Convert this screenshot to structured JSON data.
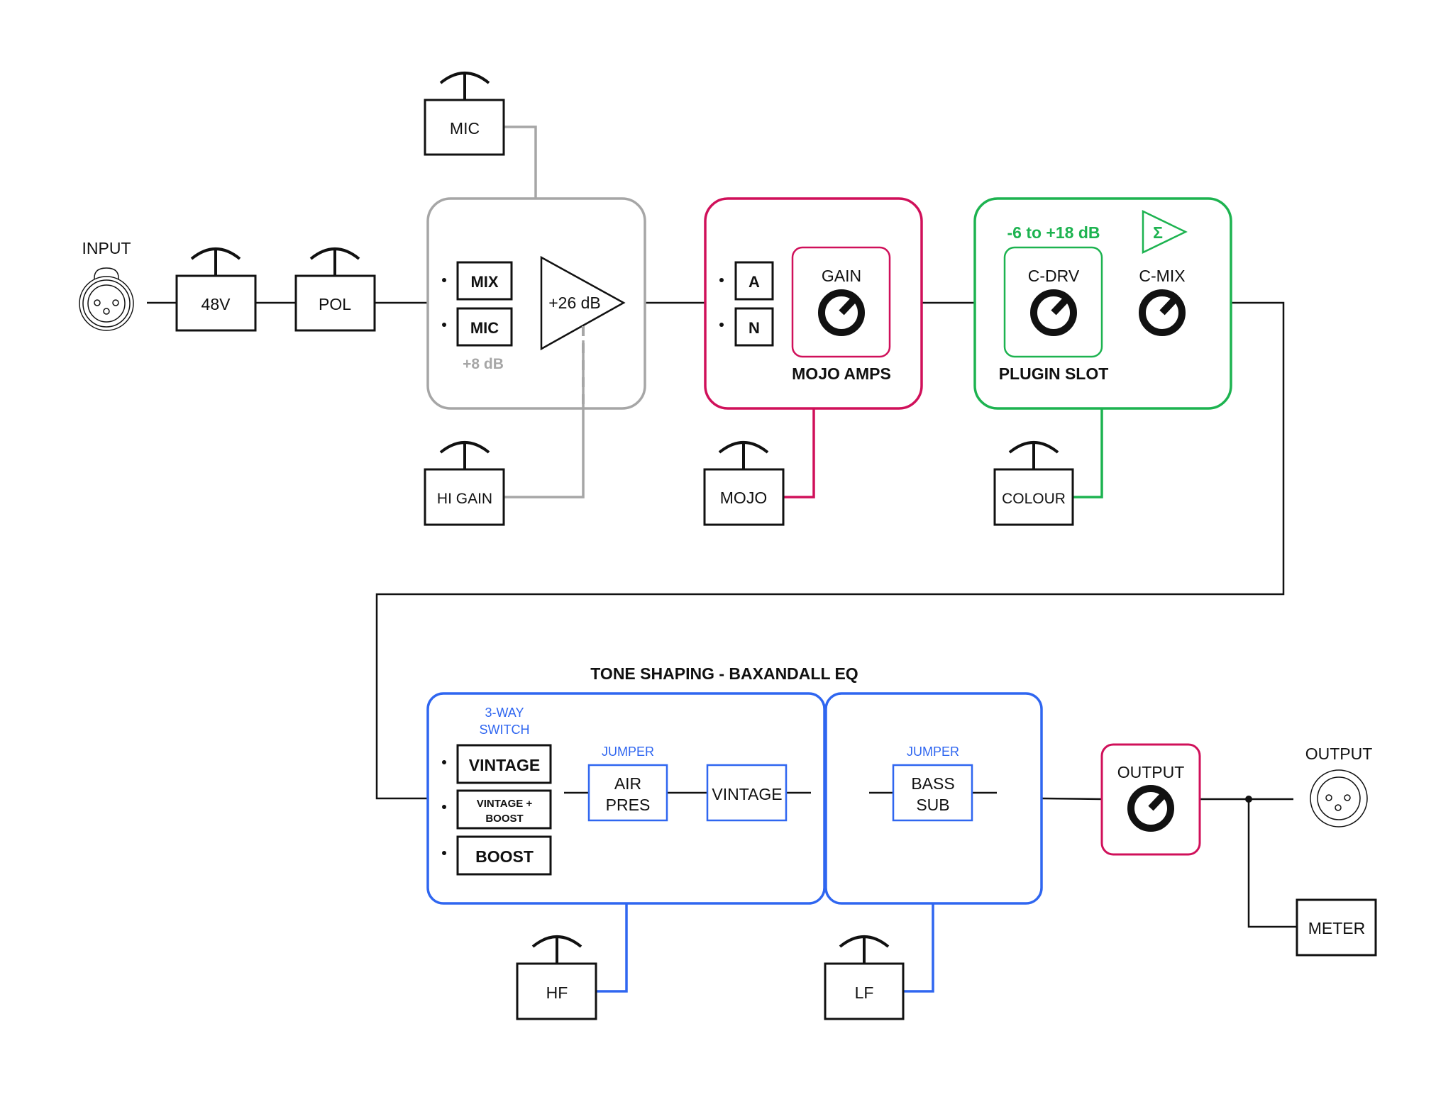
{
  "colors": {
    "line": "#111111",
    "preamp": "#a6a6a6",
    "mojo": "#d0105a",
    "plugin": "#1db350",
    "eq": "#2f66f0"
  },
  "input": {
    "label": "INPUT"
  },
  "chain": {
    "phantom": "48V",
    "polarity": "POL"
  },
  "preamp": {
    "switch_mix": "MIX",
    "switch_mic": "MIC",
    "mic_gain_note": "+8 dB",
    "amp_gain": "+26 dB",
    "control_mic": "MIC",
    "control_hi_gain": "HI GAIN"
  },
  "mojo": {
    "switch_a": "A",
    "switch_n": "N",
    "knob_label": "GAIN",
    "title": "MOJO AMPS",
    "control": "MOJO"
  },
  "plugin": {
    "range": "-6 to +18 dB",
    "sum_symbol": "Σ",
    "knob_cdrv": "C-DRV",
    "knob_cmix": "C-MIX",
    "title": "PLUGIN SLOT",
    "control": "COLOUR"
  },
  "eq": {
    "title": "TONE SHAPING - BAXANDALL EQ",
    "switch_caption_1": "3-WAY",
    "switch_caption_2": "SWITCH",
    "switch_vintage": "VINTAGE",
    "switch_vb_1": "VINTAGE +",
    "switch_vb_2": "BOOST",
    "switch_boost": "BOOST",
    "jumper_hf": "JUMPER",
    "air_1": "AIR",
    "air_2": "PRES",
    "vintage_block": "VINTAGE",
    "jumper_lf": "JUMPER",
    "bass_1": "BASS",
    "bass_2": "SUB",
    "control_hf": "HF",
    "control_lf": "LF"
  },
  "output": {
    "knob_label": "OUTPUT",
    "connector_label": "OUTPUT",
    "meter": "METER"
  }
}
